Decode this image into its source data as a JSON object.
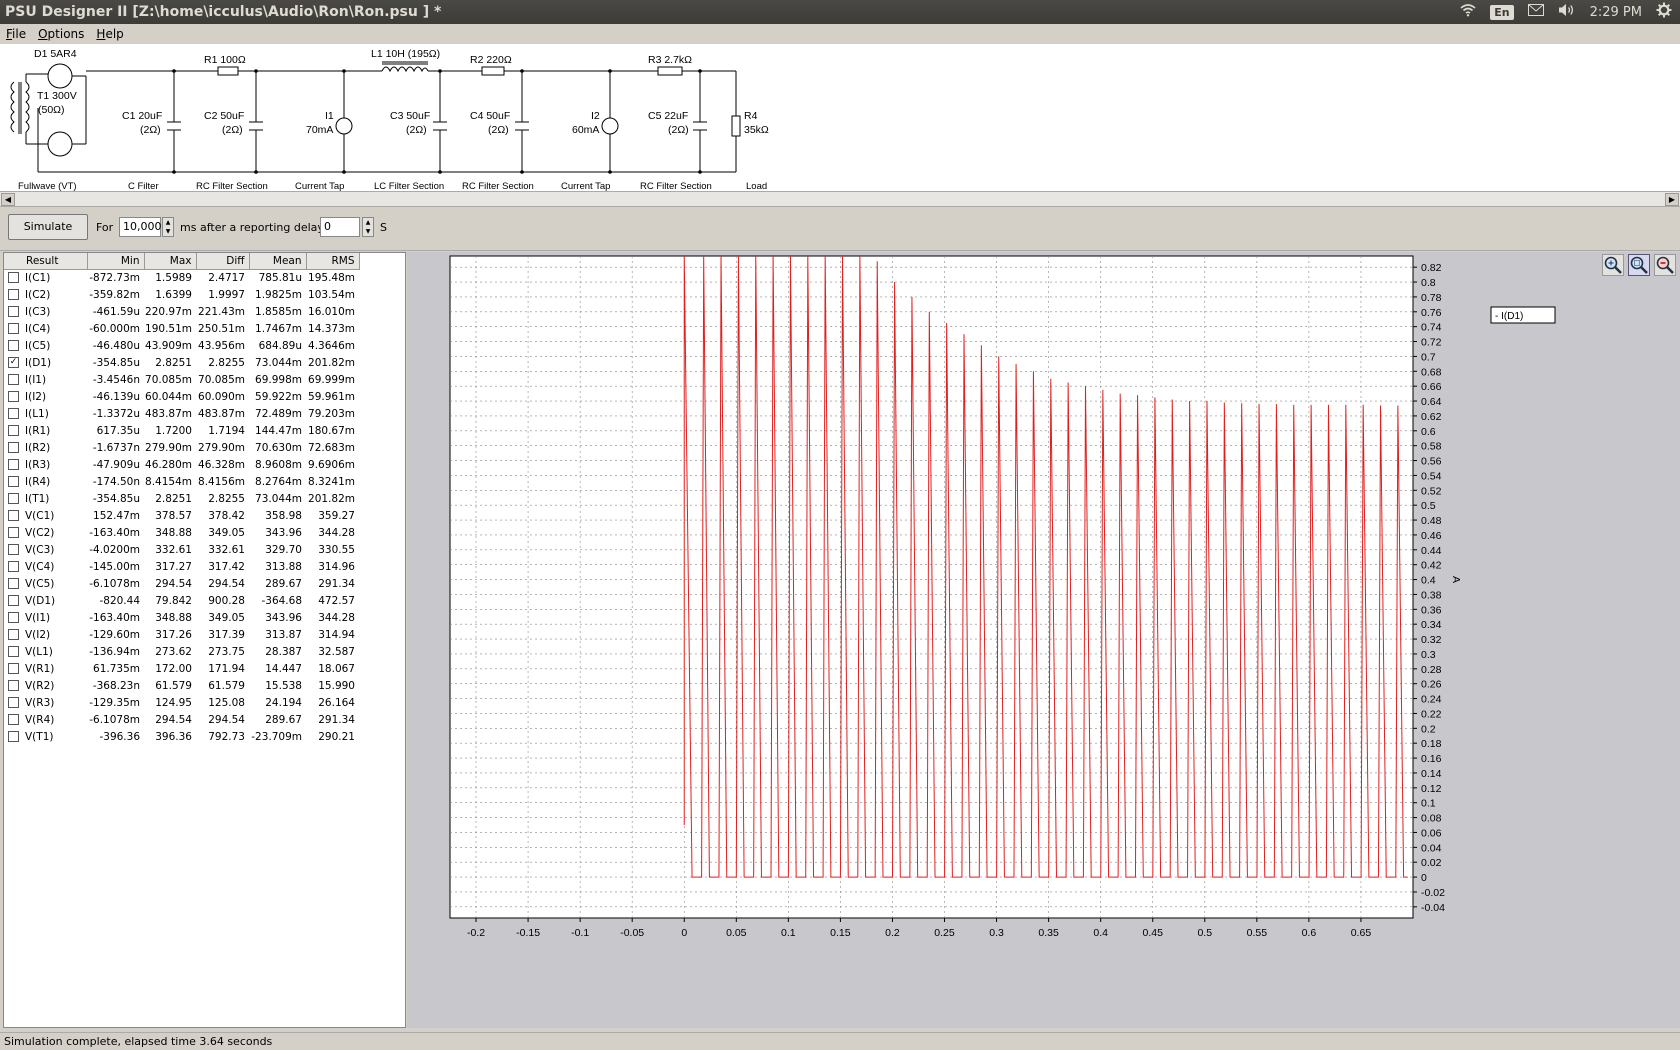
{
  "window": {
    "title": "PSU Designer II  [Z:\\home\\icculus\\Audio\\Ron\\Ron.psu ] *"
  },
  "tray": {
    "lang": "En",
    "time": "2:29 PM",
    "icons": [
      "wifi-icon",
      "mail-icon",
      "volume-icon",
      "gear-icon"
    ]
  },
  "menu": [
    "File",
    "Options",
    "Help"
  ],
  "schematic": {
    "components": [
      {
        "label": "D1 5AR4"
      },
      {
        "label": "T1 300V"
      },
      {
        "label": "(50Ω)"
      },
      {
        "label": "R1 100Ω"
      },
      {
        "label": "C1 20uF"
      },
      {
        "label": "(2Ω)"
      },
      {
        "label": "C2 50uF"
      },
      {
        "label": "(2Ω)"
      },
      {
        "label": "I1"
      },
      {
        "label": "70mA"
      },
      {
        "label": "L1 10H (195Ω)"
      },
      {
        "label": "C3 50uF"
      },
      {
        "label": "(2Ω)"
      },
      {
        "label": "R2 220Ω"
      },
      {
        "label": "C4 50uF"
      },
      {
        "label": "(2Ω)"
      },
      {
        "label": "I2"
      },
      {
        "label": "60mA"
      },
      {
        "label": "R3 2.7kΩ"
      },
      {
        "label": "C5 22uF"
      },
      {
        "label": "(2Ω)"
      },
      {
        "label": "R4"
      },
      {
        "label": "35kΩ"
      }
    ],
    "sections": [
      "Fullwave (VT)",
      "C Filter",
      "RC Filter Section",
      "Current Tap",
      "LC Filter Section",
      "RC Filter Section",
      "Current Tap",
      "RC Filter Section",
      "Load"
    ]
  },
  "toolbar": {
    "simulate_label": "Simulate",
    "for_label": "For",
    "duration_value": "10,000",
    "ms_label": "ms",
    "delay_label": "after a reporting delay of",
    "delay_value": "0",
    "s_label": "S"
  },
  "results": {
    "headers": [
      "Result",
      "Min",
      "Max",
      "Diff",
      "Mean",
      "RMS"
    ],
    "rows": [
      {
        "checked": false,
        "name": "I(C1)",
        "min": "-872.73m",
        "max": "1.5989",
        "diff": "2.4717",
        "mean": "785.81u",
        "rms": "195.48m"
      },
      {
        "checked": false,
        "name": "I(C2)",
        "min": "-359.82m",
        "max": "1.6399",
        "diff": "1.9997",
        "mean": "1.9825m",
        "rms": "103.54m"
      },
      {
        "checked": false,
        "name": "I(C3)",
        "min": "-461.59u",
        "max": "220.97m",
        "diff": "221.43m",
        "mean": "1.8585m",
        "rms": "16.010m"
      },
      {
        "checked": false,
        "name": "I(C4)",
        "min": "-60.000m",
        "max": "190.51m",
        "diff": "250.51m",
        "mean": "1.7467m",
        "rms": "14.373m"
      },
      {
        "checked": false,
        "name": "I(C5)",
        "min": "-46.480u",
        "max": "43.909m",
        "diff": "43.956m",
        "mean": "684.89u",
        "rms": "4.3646m"
      },
      {
        "checked": true,
        "name": "I(D1)",
        "min": "-354.85u",
        "max": "2.8251",
        "diff": "2.8255",
        "mean": "73.044m",
        "rms": "201.82m"
      },
      {
        "checked": false,
        "name": "I(I1)",
        "min": "-3.4546n",
        "max": "70.085m",
        "diff": "70.085m",
        "mean": "69.998m",
        "rms": "69.999m"
      },
      {
        "checked": false,
        "name": "I(I2)",
        "min": "-46.139u",
        "max": "60.044m",
        "diff": "60.090m",
        "mean": "59.922m",
        "rms": "59.961m"
      },
      {
        "checked": false,
        "name": "I(L1)",
        "min": "-1.3372u",
        "max": "483.87m",
        "diff": "483.87m",
        "mean": "72.489m",
        "rms": "79.203m"
      },
      {
        "checked": false,
        "name": "I(R1)",
        "min": "617.35u",
        "max": "1.7200",
        "diff": "1.7194",
        "mean": "144.47m",
        "rms": "180.67m"
      },
      {
        "checked": false,
        "name": "I(R2)",
        "min": "-1.6737n",
        "max": "279.90m",
        "diff": "279.90m",
        "mean": "70.630m",
        "rms": "72.683m"
      },
      {
        "checked": false,
        "name": "I(R3)",
        "min": "-47.909u",
        "max": "46.280m",
        "diff": "46.328m",
        "mean": "8.9608m",
        "rms": "9.6906m"
      },
      {
        "checked": false,
        "name": "I(R4)",
        "min": "-174.50n",
        "max": "8.4154m",
        "diff": "8.4156m",
        "mean": "8.2764m",
        "rms": "8.3241m"
      },
      {
        "checked": false,
        "name": "I(T1)",
        "min": "-354.85u",
        "max": "2.8251",
        "diff": "2.8255",
        "mean": "73.044m",
        "rms": "201.82m"
      },
      {
        "checked": false,
        "name": "V(C1)",
        "min": "152.47m",
        "max": "378.57",
        "diff": "378.42",
        "mean": "358.98",
        "rms": "359.27"
      },
      {
        "checked": false,
        "name": "V(C2)",
        "min": "-163.40m",
        "max": "348.88",
        "diff": "349.05",
        "mean": "343.96",
        "rms": "344.28"
      },
      {
        "checked": false,
        "name": "V(C3)",
        "min": "-4.0200m",
        "max": "332.61",
        "diff": "332.61",
        "mean": "329.70",
        "rms": "330.55"
      },
      {
        "checked": false,
        "name": "V(C4)",
        "min": "-145.00m",
        "max": "317.27",
        "diff": "317.42",
        "mean": "313.88",
        "rms": "314.96"
      },
      {
        "checked": false,
        "name": "V(C5)",
        "min": "-6.1078m",
        "max": "294.54",
        "diff": "294.54",
        "mean": "289.67",
        "rms": "291.34"
      },
      {
        "checked": false,
        "name": "V(D1)",
        "min": "-820.44",
        "max": "79.842",
        "diff": "900.28",
        "mean": "-364.68",
        "rms": "472.57"
      },
      {
        "checked": false,
        "name": "V(I1)",
        "min": "-163.40m",
        "max": "348.88",
        "diff": "349.05",
        "mean": "343.96",
        "rms": "344.28"
      },
      {
        "checked": false,
        "name": "V(I2)",
        "min": "-129.60m",
        "max": "317.26",
        "diff": "317.39",
        "mean": "313.87",
        "rms": "314.94"
      },
      {
        "checked": false,
        "name": "V(L1)",
        "min": "-136.94m",
        "max": "273.62",
        "diff": "273.75",
        "mean": "28.387",
        "rms": "32.587"
      },
      {
        "checked": false,
        "name": "V(R1)",
        "min": "61.735m",
        "max": "172.00",
        "diff": "171.94",
        "mean": "14.447",
        "rms": "18.067"
      },
      {
        "checked": false,
        "name": "V(R2)",
        "min": "-368.23n",
        "max": "61.579",
        "diff": "61.579",
        "mean": "15.538",
        "rms": "15.990"
      },
      {
        "checked": false,
        "name": "V(R3)",
        "min": "-129.35m",
        "max": "124.95",
        "diff": "125.08",
        "mean": "24.194",
        "rms": "26.164"
      },
      {
        "checked": false,
        "name": "V(R4)",
        "min": "-6.1078m",
        "max": "294.54",
        "diff": "294.54",
        "mean": "289.67",
        "rms": "291.34"
      },
      {
        "checked": false,
        "name": "V(T1)",
        "min": "-396.36",
        "max": "396.36",
        "diff": "792.73",
        "mean": "-23.709m",
        "rms": "290.21"
      }
    ]
  },
  "plot": {
    "legend": "- I(D1)",
    "ylabel": "A",
    "line_color": "#e02020",
    "x_ticks": [
      "-0.2",
      "-0.15",
      "-0.1",
      "-0.05",
      "0",
      "0.05",
      "0.1",
      "0.15",
      "0.2",
      "0.25",
      "0.3",
      "0.35",
      "0.4",
      "0.45",
      "0.5",
      "0.55",
      "0.6",
      "0.65"
    ],
    "y_ticks": [
      "0.82",
      "0.8",
      "0.78",
      "0.76",
      "0.74",
      "0.72",
      "0.7",
      "0.68",
      "0.66",
      "0.64",
      "0.62",
      "0.6",
      "0.58",
      "0.56",
      "0.54",
      "0.52",
      "0.5",
      "0.48",
      "0.46",
      "0.44",
      "0.42",
      "0.4",
      "0.38",
      "0.36",
      "0.34",
      "0.32",
      "0.3",
      "0.28",
      "0.26",
      "0.24",
      "0.22",
      "0.2",
      "0.18",
      "0.16",
      "0.14",
      "0.12",
      "0.1",
      "0.08",
      "0.06",
      "0.04",
      "0.02",
      "0",
      "-0.02",
      "-0.04"
    ],
    "xlim": [
      -0.225,
      0.7
    ],
    "ylim": [
      -0.055,
      0.835
    ],
    "pulse_period": 0.01667,
    "pulse_start": 0.0,
    "pulse_peaks": [
      0.835,
      0.835,
      0.835,
      0.835,
      0.835,
      0.835,
      0.835,
      0.835,
      0.835,
      0.835,
      0.835,
      0.828,
      0.8,
      0.78,
      0.76,
      0.745,
      0.73,
      0.715,
      0.7,
      0.69,
      0.68,
      0.67,
      0.665,
      0.66,
      0.655,
      0.65,
      0.648,
      0.645,
      0.642,
      0.64,
      0.64,
      0.638,
      0.637,
      0.636,
      0.636,
      0.635,
      0.635,
      0.635,
      0.635,
      0.635,
      0.634,
      0.634
    ],
    "zoom_icons": [
      "zoom-in-icon",
      "zoom-window-icon",
      "zoom-out-icon"
    ]
  },
  "status": {
    "text": "Simulation complete, elapsed time 3.64 seconds"
  }
}
